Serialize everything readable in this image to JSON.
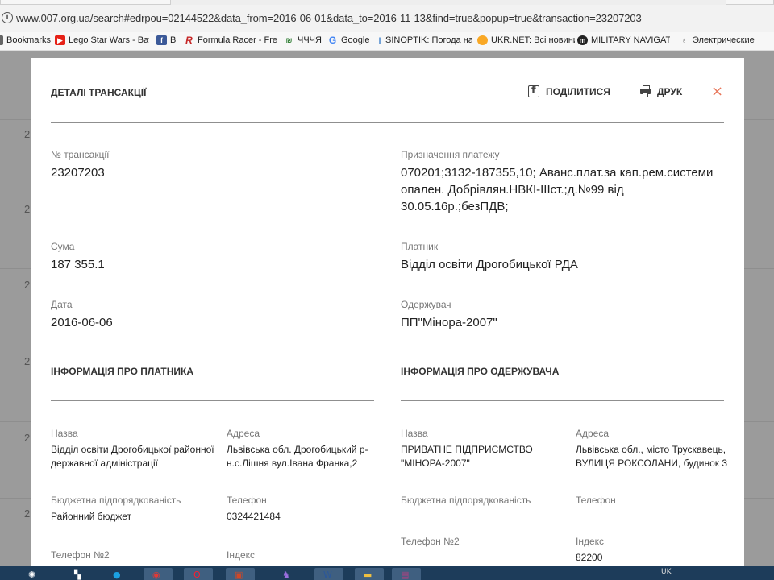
{
  "browser": {
    "url": "www.007.org.ua/search#edrpou=02144522&data_from=2016-06-01&data_to=2016-11-13&find=true&popup=true&transaction=23207203",
    "bookmarks": [
      {
        "label": "Bookmarks",
        "icon": "apps-grid-icon",
        "color": "#555555"
      },
      {
        "label": "Lego Star Wars - Batt",
        "icon": "youtube-icon",
        "color": "#e62117"
      },
      {
        "label": "B",
        "icon": "facebook-icon",
        "color": "#3b5998"
      },
      {
        "label": "Formula Racer - Free",
        "icon": "formula-logo-icon",
        "color": "#c62828"
      },
      {
        "label": "ЧЧЧЯ",
        "icon": "site-logo-icon",
        "color": "#2e7d32"
      },
      {
        "label": "Google",
        "icon": "google-icon",
        "color": "#4285f4"
      },
      {
        "label": "SINOPTIK: Погода на",
        "icon": "sinoptik-icon",
        "color": "#1565c0"
      },
      {
        "label": "UKR.NET: Всі новини",
        "icon": "ukrnet-icon",
        "color": "#f9a825"
      },
      {
        "label": "MILITARY NAVIGATOR",
        "icon": "military-icon",
        "color": "#222222"
      },
      {
        "label": "Электрические",
        "icon": "bulb-icon",
        "color": "#666666"
      }
    ]
  },
  "background_rows": [
    "2",
    "2",
    "2",
    "2",
    "2",
    "2",
    "2"
  ],
  "modal": {
    "title": "ДЕТАЛІ ТРАНСАКЦІЇ",
    "share_label": "ПОДІЛИТИСЯ",
    "print_label": "ДРУК",
    "close_symbol": "×",
    "fields": {
      "transaction_no": {
        "label": "№ трансакції",
        "value": "23207203"
      },
      "purpose": {
        "label": "Призначення платежу",
        "value": "070201;3132-187355,10; Аванс.плат.за кап.рем.системи опален. Добрівлян.НВКІ-ІІІст.;д.№99 від 30.05.16р.;безПДВ;"
      },
      "amount": {
        "label": "Сума",
        "value": "187 355.1"
      },
      "payer": {
        "label": "Платник",
        "value": "Відділ освіти Дрогобицької РДА"
      },
      "date": {
        "label": "Дата",
        "value": "2016-06-06"
      },
      "recipient": {
        "label": "Одержувач",
        "value": "ПП\"Мінора-2007\""
      }
    },
    "payer_info": {
      "title": "ІНФОРМАЦІЯ ПРО ПЛАТНИКА",
      "name_label": "Назва",
      "name_value": "Відділ освіти Дрогобицької районної державної адміністрації",
      "address_label": "Адреса",
      "address_value": "Львівська обл. Дрогобицький р-н.с.Лішня вул.Івана Франка,2",
      "budget_label": "Бюджетна підпорядкованість",
      "budget_value": "Районний бюджет",
      "phone_label": "Телефон",
      "phone_value": "0324421484",
      "phone2_label": "Телефон №2",
      "index_label": "Індекс"
    },
    "recipient_info": {
      "title": "ІНФОРМАЦІЯ ПРО ОДЕРЖУВАЧА",
      "name_label": "Назва",
      "name_value": "ПРИВАТНЕ ПІДПРИЄМСТВО \"МІНОРА-2007\"",
      "address_label": "Адреса",
      "address_value": "Львівська обл., місто Трускавець, ВУЛИЦЯ РОКСОЛАНИ, будинок 3",
      "budget_label": "Бюджетна підпорядкованість",
      "phone_label": "Телефон",
      "phone2_label": "Телефон №2",
      "index_label": "Індекс",
      "index_value": "82200"
    }
  },
  "taskbar": {
    "items": [
      {
        "icon": "windows-start-icon"
      },
      {
        "icon": "app-icon"
      },
      {
        "icon": "skype-icon"
      },
      {
        "icon": "chrome-icon"
      },
      {
        "icon": "opera-icon"
      },
      {
        "icon": "powerpoint-icon"
      },
      {
        "icon": "wizard-icon"
      },
      {
        "icon": "word-icon"
      },
      {
        "icon": "folder-icon"
      },
      {
        "icon": "winrar-icon"
      }
    ],
    "tray_lang": "UK"
  }
}
